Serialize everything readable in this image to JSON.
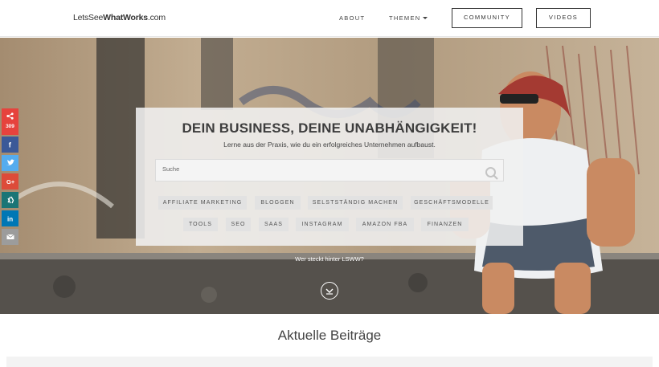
{
  "header": {
    "logo_prefix": "LetsSee",
    "logo_bold": "WhatWorks",
    "logo_suffix": ".com",
    "nav_about": "ABOUT",
    "nav_themen": "THEMEN",
    "community_button": "COMMUNITY",
    "videos_button": "VIDEOS"
  },
  "hero": {
    "title": "DEIN BUSINESS, DEINE UNABHÄNGIGKEIT!",
    "subtitle": "Lerne aus der Praxis, wie du ein erfolgreiches Unternehmen aufbaust.",
    "search_placeholder": "Suche",
    "tags_row1": [
      "AFFILIATE MARKETING",
      "BLOGGEN",
      "SELSTSTÄNDIG MACHEN",
      "GESCHÄFTSMODELLE"
    ],
    "tags_row2": [
      "TOOLS",
      "SEO",
      "SAAS",
      "INSTAGRAM",
      "AMAZON FBA",
      "FINANZEN"
    ],
    "who_link": "Wer steckt hinter LSWW?"
  },
  "social": {
    "share_count": "309",
    "buttons": [
      {
        "name": "facebook",
        "color": "#3b5998"
      },
      {
        "name": "twitter",
        "color": "#55acee"
      },
      {
        "name": "google-plus",
        "color": "#dd4b39"
      },
      {
        "name": "xing",
        "color": "#1a7576"
      },
      {
        "name": "linkedin",
        "color": "#0077b5"
      },
      {
        "name": "email",
        "color": "#999999"
      }
    ]
  },
  "main": {
    "section_title": "Aktuelle Beiträge"
  }
}
